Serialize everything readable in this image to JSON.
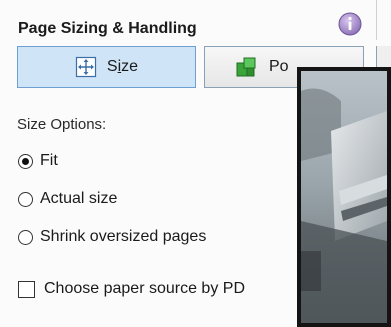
{
  "section": {
    "title": "Page Sizing & Handling",
    "info_icon": "info-icon"
  },
  "buttons": {
    "size": {
      "label_pre": "S",
      "label_u": "i",
      "label_post": "ze",
      "icon": "size-icon",
      "selected": true
    },
    "poster": {
      "label": "Po",
      "icon": "poster-icon",
      "selected": false
    }
  },
  "size_options": {
    "label": "Size Options:",
    "radios": [
      {
        "label": "Fit",
        "checked": true
      },
      {
        "label": "Actual size",
        "checked": false
      },
      {
        "label": "Shrink oversized pages",
        "checked": false
      }
    ]
  },
  "paper_source": {
    "label": "Choose paper source by PD",
    "checked": false
  },
  "colors": {
    "selected_button_bg": "#cfe4f7",
    "selected_button_border": "#6d9fd0",
    "overlay_border": "#141414"
  }
}
